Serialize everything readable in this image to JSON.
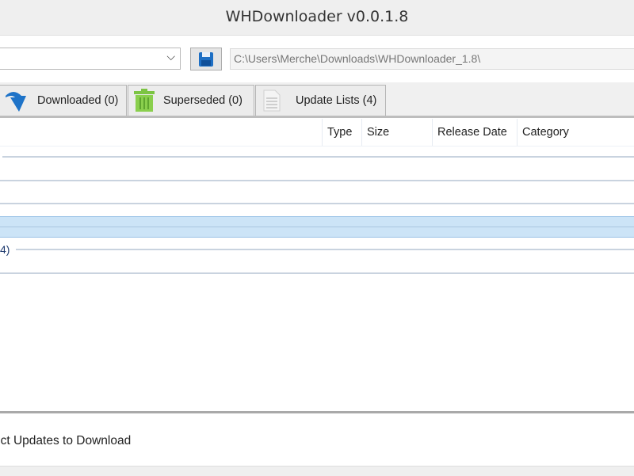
{
  "window": {
    "title": "WHDownloader v0.0.1.8"
  },
  "toolbar": {
    "combo_value": "",
    "save_icon": "floppy-disk-icon",
    "path": "C:\\Users\\Merche\\Downloads\\WHDownloader_1.8\\"
  },
  "tabs": [
    {
      "label": "Downloaded (0)",
      "icon": "download-arrow-icon"
    },
    {
      "label": "Superseded (0)",
      "icon": "trash-icon"
    },
    {
      "label": "Update Lists (4)",
      "icon": "document-icon"
    }
  ],
  "table": {
    "columns": [
      "Type",
      "Size",
      "Release Date",
      "Category"
    ],
    "group_label": "4)"
  },
  "status": {
    "text": "ect Updates to Download"
  },
  "colors": {
    "selection": "#cce4f7",
    "accent": "#1e73c8"
  }
}
